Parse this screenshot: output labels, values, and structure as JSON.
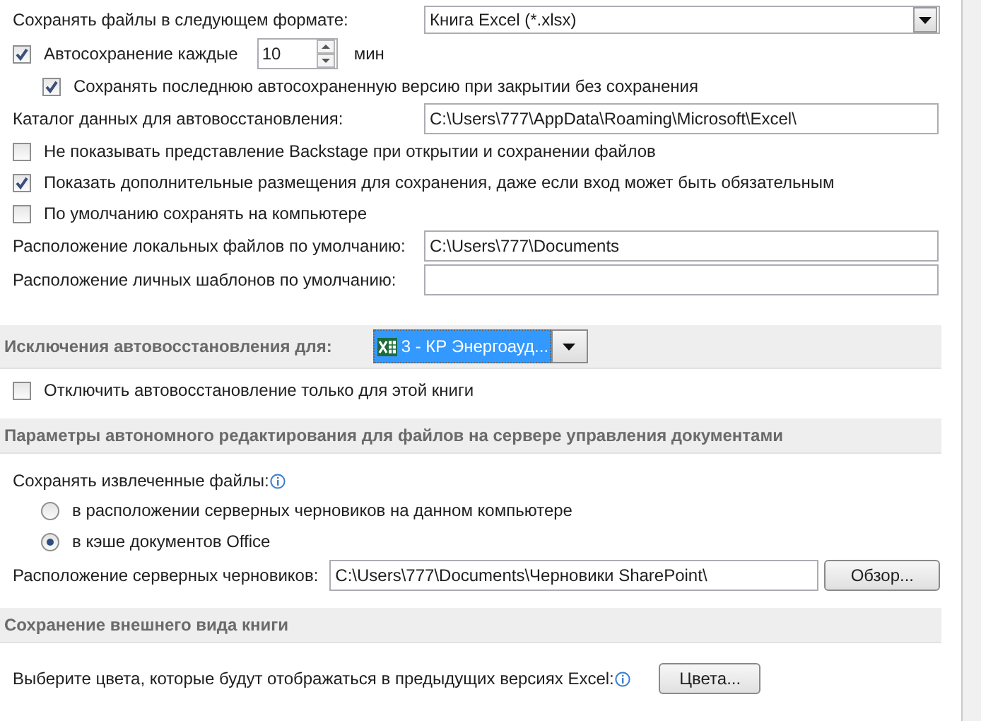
{
  "sections": [
    {
      "items": [
        {
          "kind": "select",
          "label": "Сохранять файлы в следующем формате:",
          "value": "Книга Excel (*.xlsx)"
        },
        {
          "kind": "spin",
          "label": "Автосохранение каждые",
          "checked": true,
          "value": "10",
          "unit": "мин",
          "children": [
            {
              "kind": "checkbox",
              "label": "Сохранять последнюю автосохраненную версию при закрытии без сохранения",
              "checked": true
            }
          ]
        },
        {
          "kind": "field",
          "label": "Каталог данных для автовосстановления:",
          "value": "C:\\Users\\777\\AppData\\Roaming\\Microsoft\\Excel\\"
        },
        {
          "kind": "checkbox",
          "label": "Не показывать представление Backstage при открытии и сохранении файлов",
          "checked": false
        },
        {
          "kind": "checkbox",
          "label": "Показать дополнительные размещения для сохранения, даже если вход может быть обязательным",
          "checked": true
        },
        {
          "kind": "checkbox",
          "label": "По умолчанию сохранять на компьютере",
          "checked": false
        },
        {
          "kind": "field",
          "label": "Расположение локальных файлов по умолчанию:",
          "value": "C:\\Users\\777\\Documents"
        },
        {
          "kind": "field",
          "label": "Расположение личных шаблонов по умолчанию:",
          "value": ""
        }
      ]
    },
    {
      "heading": "Исключения автовосстановления для:",
      "workbook": "3 -  КР Энергоауд...",
      "items": [
        {
          "kind": "checkbox",
          "label": "Отключить автовосстановление только для этой книги",
          "checked": false
        }
      ]
    },
    {
      "heading": "Параметры автономного редактирования для файлов на сервере управления документами",
      "items": [
        {
          "kind": "radios",
          "label": "Сохранять извлеченные файлы:",
          "info": true,
          "options": [
            {
              "label": "в расположении серверных черновиков на данном компьютере",
              "selected": false
            },
            {
              "label": "в кэше документов Office",
              "selected": true
            }
          ]
        },
        {
          "kind": "field_button",
          "label": "Расположение серверных черновиков:",
          "value": "C:\\Users\\777\\Documents\\Черновики SharePoint\\",
          "button": "Обзор..."
        }
      ]
    },
    {
      "heading": "Сохранение внешнего вида книги",
      "items": [
        {
          "kind": "button_row",
          "label": "Выберите цвета, которые будут отображаться в предыдущих версиях Excel:",
          "info": true,
          "button": "Цвета..."
        }
      ]
    }
  ]
}
